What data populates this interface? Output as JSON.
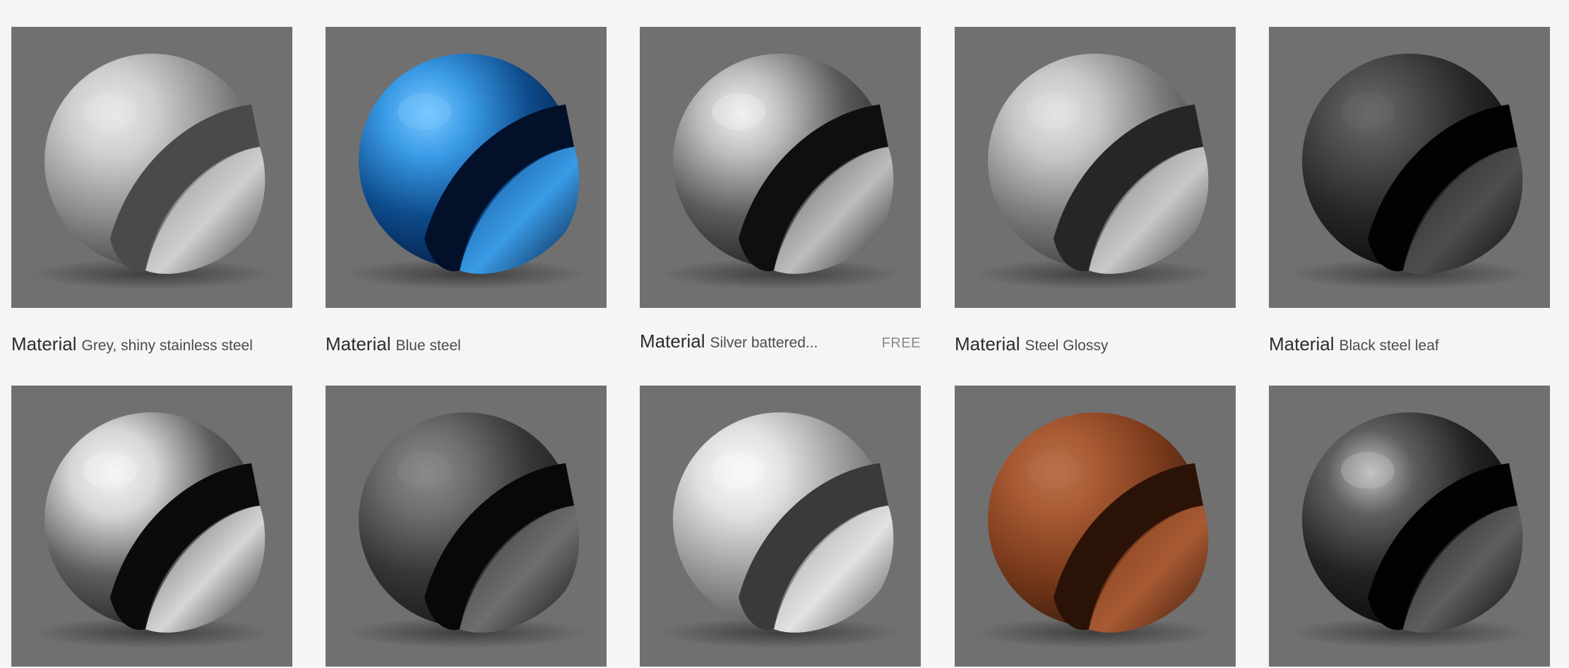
{
  "materials": [
    {
      "type": "Material",
      "name": "Grey, shiny stainless steel",
      "price": "",
      "sphere": {
        "dark": "#3c3c3c",
        "mid": "#8d8d8d",
        "light": "#cfcfcf",
        "slot": "#4a4a4a",
        "hilite": "#e8e8e8"
      }
    },
    {
      "type": "Material",
      "name": "Blue steel",
      "price": "",
      "sphere": {
        "dark": "#031a3e",
        "mid": "#0d4a8a",
        "light": "#3a9be6",
        "slot": "#02102a",
        "hilite": "#7cc8ff"
      }
    },
    {
      "type": "Material",
      "name": "Silver battered...",
      "price": "FREE",
      "sphere": {
        "dark": "#1c1c1c",
        "mid": "#5a5a5a",
        "light": "#bdbdbd",
        "slot": "#0f0f0f",
        "hilite": "#f2f2f2"
      }
    },
    {
      "type": "Material",
      "name": "Steel Glossy",
      "price": "",
      "sphere": {
        "dark": "#3a3a3a",
        "mid": "#7d7d7d",
        "light": "#c8c8c8",
        "slot": "#262626",
        "hilite": "#e3e3e3"
      }
    },
    {
      "type": "Material",
      "name": "Black steel leaf",
      "price": "",
      "sphere": {
        "dark": "#090909",
        "mid": "#262626",
        "light": "#4e4e4e",
        "slot": "#020202",
        "hilite": "#6a6a6a"
      }
    },
    {
      "type": "",
      "name": "",
      "price": "",
      "sphere": {
        "dark": "#1e1e1e",
        "mid": "#5e5e5e",
        "light": "#d6d6d6",
        "slot": "#0b0b0b",
        "hilite": "#f5f5f5"
      }
    },
    {
      "type": "",
      "name": "",
      "price": "",
      "sphere": {
        "dark": "#151515",
        "mid": "#363636",
        "light": "#6e6e6e",
        "slot": "#080808",
        "hilite": "#8a8a8a"
      }
    },
    {
      "type": "",
      "name": "",
      "price": "",
      "sphere": {
        "dark": "#4e4e4e",
        "mid": "#9a9a9a",
        "light": "#e2e2e2",
        "slot": "#3a3a3a",
        "hilite": "#fafafa"
      }
    },
    {
      "type": "",
      "name": "",
      "price": "",
      "sphere": {
        "dark": "#3a1a0a",
        "mid": "#7a3a1c",
        "light": "#a85a33",
        "slot": "#2a1206",
        "hilite": "#b9704a"
      }
    },
    {
      "type": "",
      "name": "",
      "price": "",
      "sphere": {
        "dark": "#080808",
        "mid": "#222222",
        "light": "#5e5e5e",
        "slot": "#020202",
        "hilite": "#c4c4c4"
      }
    }
  ]
}
